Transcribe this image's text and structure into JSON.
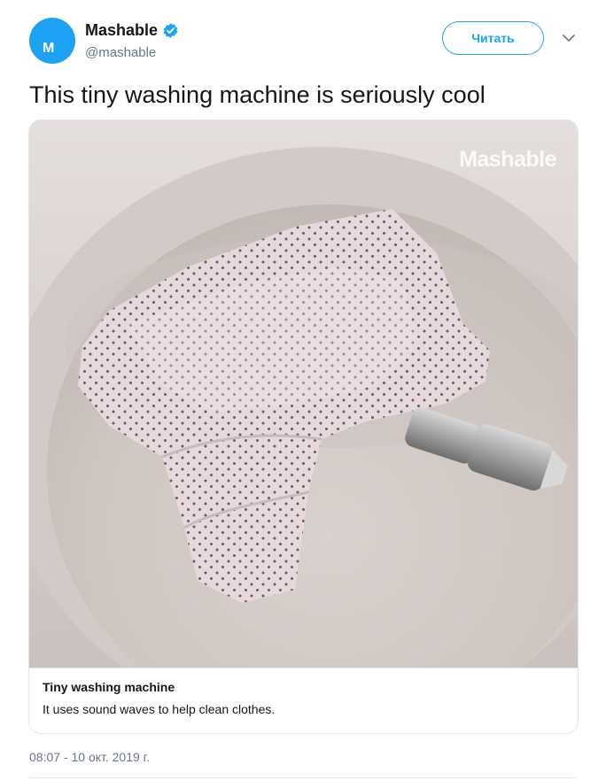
{
  "tweet": {
    "author": {
      "avatar_letter": "M",
      "display_name": "Mashable",
      "handle": "@mashable",
      "verified": true
    },
    "follow_label": "Читать",
    "text": "This tiny washing machine is seriously cool",
    "media": {
      "watermark": "Mashable",
      "card_title": "Tiny washing machine",
      "card_description": "It uses sound waves to help clean clothes."
    },
    "timestamp": "08:07 - 10 окт. 2019 г."
  },
  "icons": {
    "verified": "verified-badge-icon",
    "caret": "chevron-down-icon"
  },
  "colors": {
    "accent": "#1da1f2",
    "secondary_text": "#657786",
    "border": "#e1e8ed"
  }
}
